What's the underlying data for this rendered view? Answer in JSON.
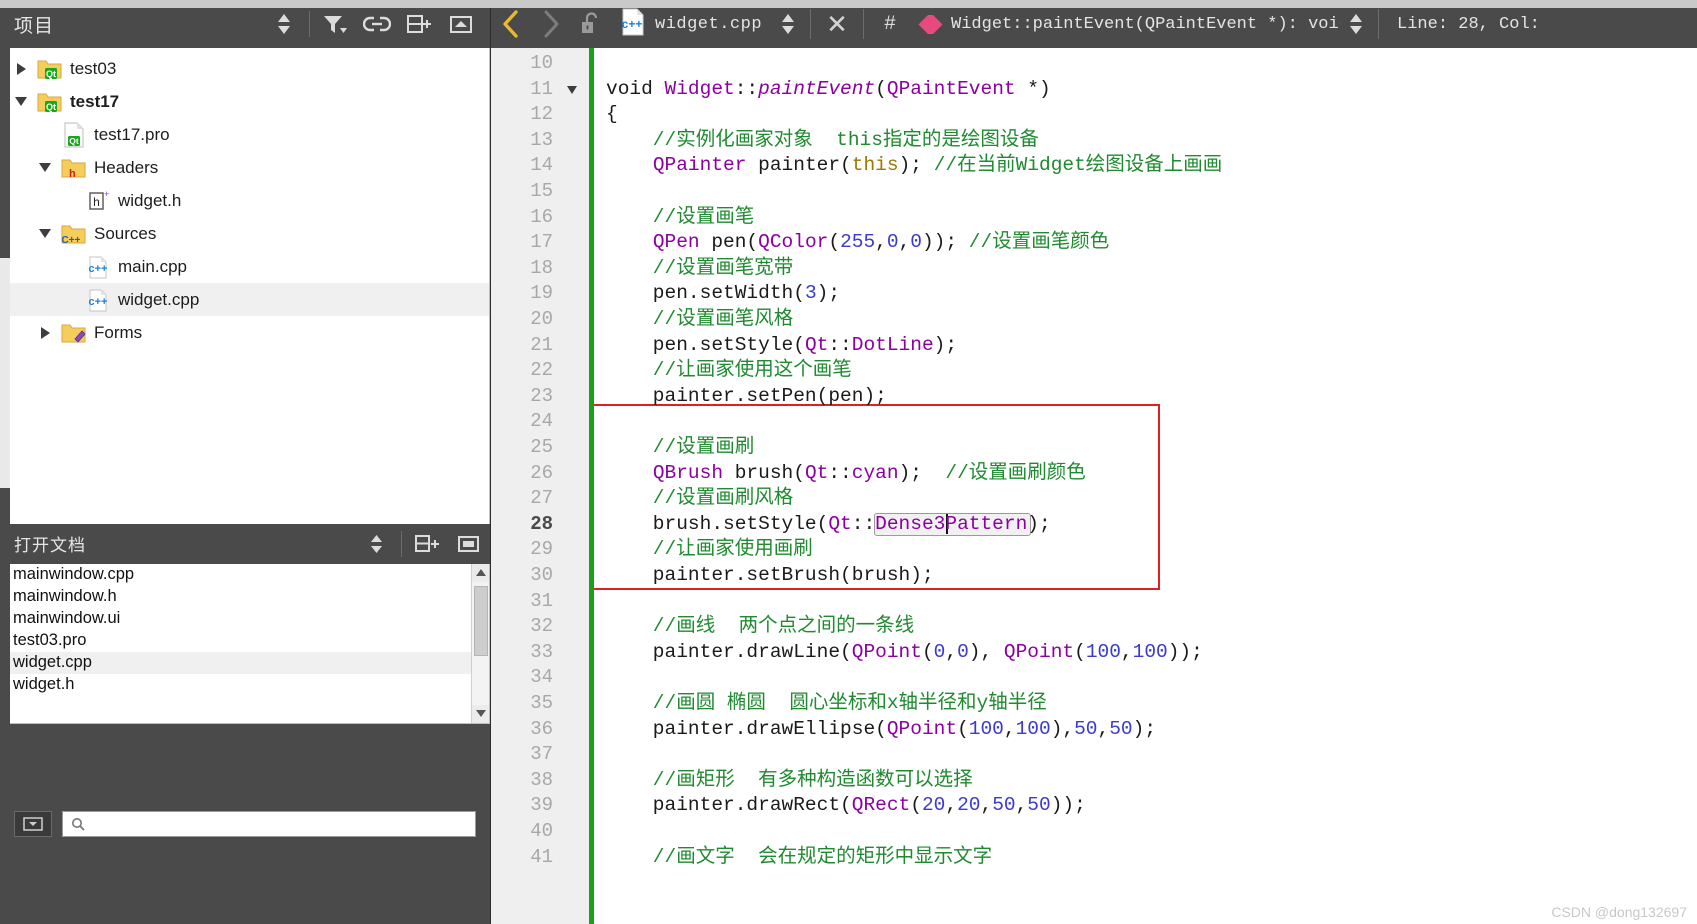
{
  "sidebar": {
    "projects_panel": {
      "title": "项目",
      "tools": [
        {
          "name": "sync-with-editor-icon",
          "glyph": "updown"
        },
        {
          "name": "filter-icon",
          "glyph": "filter"
        },
        {
          "name": "link-icon",
          "glyph": "link"
        },
        {
          "name": "split-add-icon",
          "glyph": "splitadd"
        },
        {
          "name": "close-split-icon",
          "glyph": "closesplit"
        }
      ]
    },
    "tree": [
      {
        "label": "test03",
        "icon": "qt-project-folder-icon",
        "indent": 0,
        "expander": "right",
        "bold": false,
        "selected": false
      },
      {
        "label": "test17",
        "icon": "qt-project-folder-icon",
        "indent": 0,
        "expander": "down",
        "bold": true,
        "selected": false
      },
      {
        "label": "test17.pro",
        "icon": "qt-pro-file-icon",
        "indent": 1,
        "expander": "none",
        "bold": false,
        "selected": false
      },
      {
        "label": "Headers",
        "icon": "headers-folder-icon",
        "indent": 1,
        "expander": "down",
        "bold": false,
        "selected": false
      },
      {
        "label": "widget.h",
        "icon": "h-file-icon",
        "indent": 2,
        "expander": "none",
        "bold": false,
        "selected": false
      },
      {
        "label": "Sources",
        "icon": "sources-folder-icon",
        "indent": 1,
        "expander": "down",
        "bold": false,
        "selected": false
      },
      {
        "label": "main.cpp",
        "icon": "cpp-file-icon",
        "indent": 2,
        "expander": "none",
        "bold": false,
        "selected": false
      },
      {
        "label": "widget.cpp",
        "icon": "cpp-file-icon",
        "indent": 2,
        "expander": "none",
        "bold": false,
        "selected": true
      },
      {
        "label": "Forms",
        "icon": "forms-folder-icon",
        "indent": 1,
        "expander": "right",
        "bold": false,
        "selected": false
      }
    ],
    "open_documents_panel": {
      "title": "打开文档",
      "tools": [
        {
          "name": "sync-with-editor-icon",
          "glyph": "updown"
        },
        {
          "name": "split-add-icon",
          "glyph": "splitadd"
        },
        {
          "name": "close-split-icon",
          "glyph": "closesplit"
        }
      ],
      "items": [
        {
          "label": "mainwindow.cpp",
          "selected": false
        },
        {
          "label": "mainwindow.h",
          "selected": false
        },
        {
          "label": "mainwindow.ui",
          "selected": false
        },
        {
          "label": "test03.pro",
          "selected": false
        },
        {
          "label": "widget.cpp",
          "selected": true
        },
        {
          "label": "widget.h",
          "selected": false
        }
      ]
    },
    "search_bar": {
      "placeholder": ""
    }
  },
  "editor": {
    "toolbar": {
      "back_icon": "back-arrow-icon",
      "forward_icon": "forward-arrow-icon",
      "lock_icon": "unlocked-padlock-icon",
      "file_type_icon": "cpp-file-icon",
      "filename": "widget.cpp",
      "updown_icon": "document-dropdown-icon",
      "close_label": "✕",
      "hash_label": "#",
      "symbol_icon": "function-symbol-icon",
      "symbol": "Widget::paintEvent(QPaintEvent *): void",
      "symbol_updown_icon": "symbol-dropdown-icon",
      "position": "Line: 28, Col:"
    },
    "cursor": {
      "line": 28,
      "column": 31
    },
    "first_visible_line": 10,
    "lines": [
      {
        "n": 10,
        "tokens": []
      },
      {
        "n": 11,
        "fold": true,
        "tokens": [
          {
            "t": "void ",
            "c": "t-void"
          },
          {
            "t": "Widget",
            "c": "t-kw"
          },
          {
            "t": "::",
            "c": "t-plain"
          },
          {
            "t": "paintEvent",
            "c": "t-italic"
          },
          {
            "t": "(",
            "c": "t-plain"
          },
          {
            "t": "QPaintEvent",
            "c": "t-kw"
          },
          {
            "t": " *)",
            "c": "t-plain"
          }
        ]
      },
      {
        "n": 12,
        "tokens": [
          {
            "t": "{",
            "c": "t-plain"
          }
        ]
      },
      {
        "n": 13,
        "tokens": [
          {
            "t": "    //实例化画家对象  this指定的是绘图设备",
            "c": "t-cmt"
          }
        ]
      },
      {
        "n": 14,
        "tokens": [
          {
            "t": "    ",
            "c": "t-plain"
          },
          {
            "t": "QPainter",
            "c": "t-kw"
          },
          {
            "t": " painter(",
            "c": "t-plain"
          },
          {
            "t": "this",
            "c": "t-this"
          },
          {
            "t": "); ",
            "c": "t-plain"
          },
          {
            "t": "//在当前Widget绘图设备上画画",
            "c": "t-cmt"
          }
        ]
      },
      {
        "n": 15,
        "tokens": []
      },
      {
        "n": 16,
        "tokens": [
          {
            "t": "    //设置画笔",
            "c": "t-cmt"
          }
        ]
      },
      {
        "n": 17,
        "tokens": [
          {
            "t": "    ",
            "c": "t-plain"
          },
          {
            "t": "QPen",
            "c": "t-kw"
          },
          {
            "t": " pen(",
            "c": "t-plain"
          },
          {
            "t": "QColor",
            "c": "t-kw"
          },
          {
            "t": "(",
            "c": "t-plain"
          },
          {
            "t": "255",
            "c": "t-num"
          },
          {
            "t": ",",
            "c": "t-plain"
          },
          {
            "t": "0",
            "c": "t-num"
          },
          {
            "t": ",",
            "c": "t-plain"
          },
          {
            "t": "0",
            "c": "t-num"
          },
          {
            "t": ")); ",
            "c": "t-plain"
          },
          {
            "t": "//设置画笔颜色",
            "c": "t-cmt"
          }
        ]
      },
      {
        "n": 18,
        "tokens": [
          {
            "t": "    //设置画笔宽带",
            "c": "t-cmt"
          }
        ]
      },
      {
        "n": 19,
        "tokens": [
          {
            "t": "    pen.setWidth(",
            "c": "t-plain"
          },
          {
            "t": "3",
            "c": "t-num"
          },
          {
            "t": ");",
            "c": "t-plain"
          }
        ]
      },
      {
        "n": 20,
        "tokens": [
          {
            "t": "    //设置画笔风格",
            "c": "t-cmt"
          }
        ]
      },
      {
        "n": 21,
        "tokens": [
          {
            "t": "    pen.setStyle(",
            "c": "t-plain"
          },
          {
            "t": "Qt",
            "c": "t-kw"
          },
          {
            "t": "::",
            "c": "t-plain"
          },
          {
            "t": "DotLine",
            "c": "t-kw"
          },
          {
            "t": ");",
            "c": "t-plain"
          }
        ]
      },
      {
        "n": 22,
        "tokens": [
          {
            "t": "    //让画家使用这个画笔",
            "c": "t-cmt"
          }
        ]
      },
      {
        "n": 23,
        "tokens": [
          {
            "t": "    painter.setPen(pen);",
            "c": "t-plain"
          }
        ]
      },
      {
        "n": 24,
        "tokens": []
      },
      {
        "n": 25,
        "tokens": [
          {
            "t": "    //设置画刷",
            "c": "t-cmt"
          }
        ]
      },
      {
        "n": 26,
        "tokens": [
          {
            "t": "    ",
            "c": "t-plain"
          },
          {
            "t": "QBrush",
            "c": "t-kw"
          },
          {
            "t": " brush(",
            "c": "t-plain"
          },
          {
            "t": "Qt",
            "c": "t-kw"
          },
          {
            "t": "::",
            "c": "t-plain"
          },
          {
            "t": "cyan",
            "c": "t-kw"
          },
          {
            "t": ");  ",
            "c": "t-plain"
          },
          {
            "t": "//设置画刷颜色",
            "c": "t-cmt"
          }
        ]
      },
      {
        "n": 27,
        "tokens": [
          {
            "t": "    //设置画刷风格",
            "c": "t-cmt"
          }
        ]
      },
      {
        "n": 28,
        "current": true,
        "tokens": [
          {
            "t": "    brush.setStyle(",
            "c": "t-plain"
          },
          {
            "t": "Qt",
            "c": "t-kw"
          },
          {
            "t": "::",
            "c": "t-plain"
          },
          {
            "t": "Dense3Pattern",
            "c": "t-kw"
          },
          {
            "t": ");",
            "c": "t-plain"
          }
        ]
      },
      {
        "n": 29,
        "tokens": [
          {
            "t": "    //让画家使用画刷",
            "c": "t-cmt"
          }
        ]
      },
      {
        "n": 30,
        "tokens": [
          {
            "t": "    painter.setBrush(brush);",
            "c": "t-plain"
          }
        ]
      },
      {
        "n": 31,
        "tokens": []
      },
      {
        "n": 32,
        "tokens": [
          {
            "t": "    //画线  两个点之间的一条线",
            "c": "t-cmt"
          }
        ]
      },
      {
        "n": 33,
        "tokens": [
          {
            "t": "    painter.drawLine(",
            "c": "t-plain"
          },
          {
            "t": "QPoint",
            "c": "t-kw"
          },
          {
            "t": "(",
            "c": "t-plain"
          },
          {
            "t": "0",
            "c": "t-num"
          },
          {
            "t": ",",
            "c": "t-plain"
          },
          {
            "t": "0",
            "c": "t-num"
          },
          {
            "t": "), ",
            "c": "t-plain"
          },
          {
            "t": "QPoint",
            "c": "t-kw"
          },
          {
            "t": "(",
            "c": "t-plain"
          },
          {
            "t": "100",
            "c": "t-num"
          },
          {
            "t": ",",
            "c": "t-plain"
          },
          {
            "t": "100",
            "c": "t-num"
          },
          {
            "t": "));",
            "c": "t-plain"
          }
        ]
      },
      {
        "n": 34,
        "tokens": []
      },
      {
        "n": 35,
        "tokens": [
          {
            "t": "    //画圆 椭圆  圆心坐标和x轴半径和y轴半径",
            "c": "t-cmt"
          }
        ]
      },
      {
        "n": 36,
        "tokens": [
          {
            "t": "    painter.drawEllipse(",
            "c": "t-plain"
          },
          {
            "t": "QPoint",
            "c": "t-kw"
          },
          {
            "t": "(",
            "c": "t-plain"
          },
          {
            "t": "100",
            "c": "t-num"
          },
          {
            "t": ",",
            "c": "t-plain"
          },
          {
            "t": "100",
            "c": "t-num"
          },
          {
            "t": "),",
            "c": "t-plain"
          },
          {
            "t": "50",
            "c": "t-num"
          },
          {
            "t": ",",
            "c": "t-plain"
          },
          {
            "t": "50",
            "c": "t-num"
          },
          {
            "t": ");",
            "c": "t-plain"
          }
        ]
      },
      {
        "n": 37,
        "tokens": []
      },
      {
        "n": 38,
        "tokens": [
          {
            "t": "    //画矩形  有多种构造函数可以选择",
            "c": "t-cmt"
          }
        ]
      },
      {
        "n": 39,
        "tokens": [
          {
            "t": "    painter.drawRect(",
            "c": "t-plain"
          },
          {
            "t": "QRect",
            "c": "t-kw"
          },
          {
            "t": "(",
            "c": "t-plain"
          },
          {
            "t": "20",
            "c": "t-num"
          },
          {
            "t": ",",
            "c": "t-plain"
          },
          {
            "t": "20",
            "c": "t-num"
          },
          {
            "t": ",",
            "c": "t-plain"
          },
          {
            "t": "50",
            "c": "t-num"
          },
          {
            "t": ",",
            "c": "t-plain"
          },
          {
            "t": "50",
            "c": "t-num"
          },
          {
            "t": "));",
            "c": "t-plain"
          }
        ]
      },
      {
        "n": 40,
        "tokens": []
      },
      {
        "n": 41,
        "tokens": [
          {
            "t": "    //画文字  会在规定的矩形中显示文字",
            "c": "t-cmt"
          }
        ]
      }
    ],
    "annotation_box": {
      "color": "#e02020",
      "from_line": 24,
      "to_line": 30
    },
    "occurrence_highlight": {
      "text": "Dense3Pattern",
      "line": 28
    }
  },
  "watermark": "CSDN @dong132697",
  "colors": {
    "chrome": "#4a4a4a",
    "gutter": "#efefef",
    "change_bar": "#18a018",
    "comment": "#1f8a2f",
    "type": "#8b00a0",
    "number": "#3a3ad0",
    "keyword_this": "#9a7a00",
    "annotation_red": "#e02020",
    "symbol_diamond": "#e84a7f"
  }
}
